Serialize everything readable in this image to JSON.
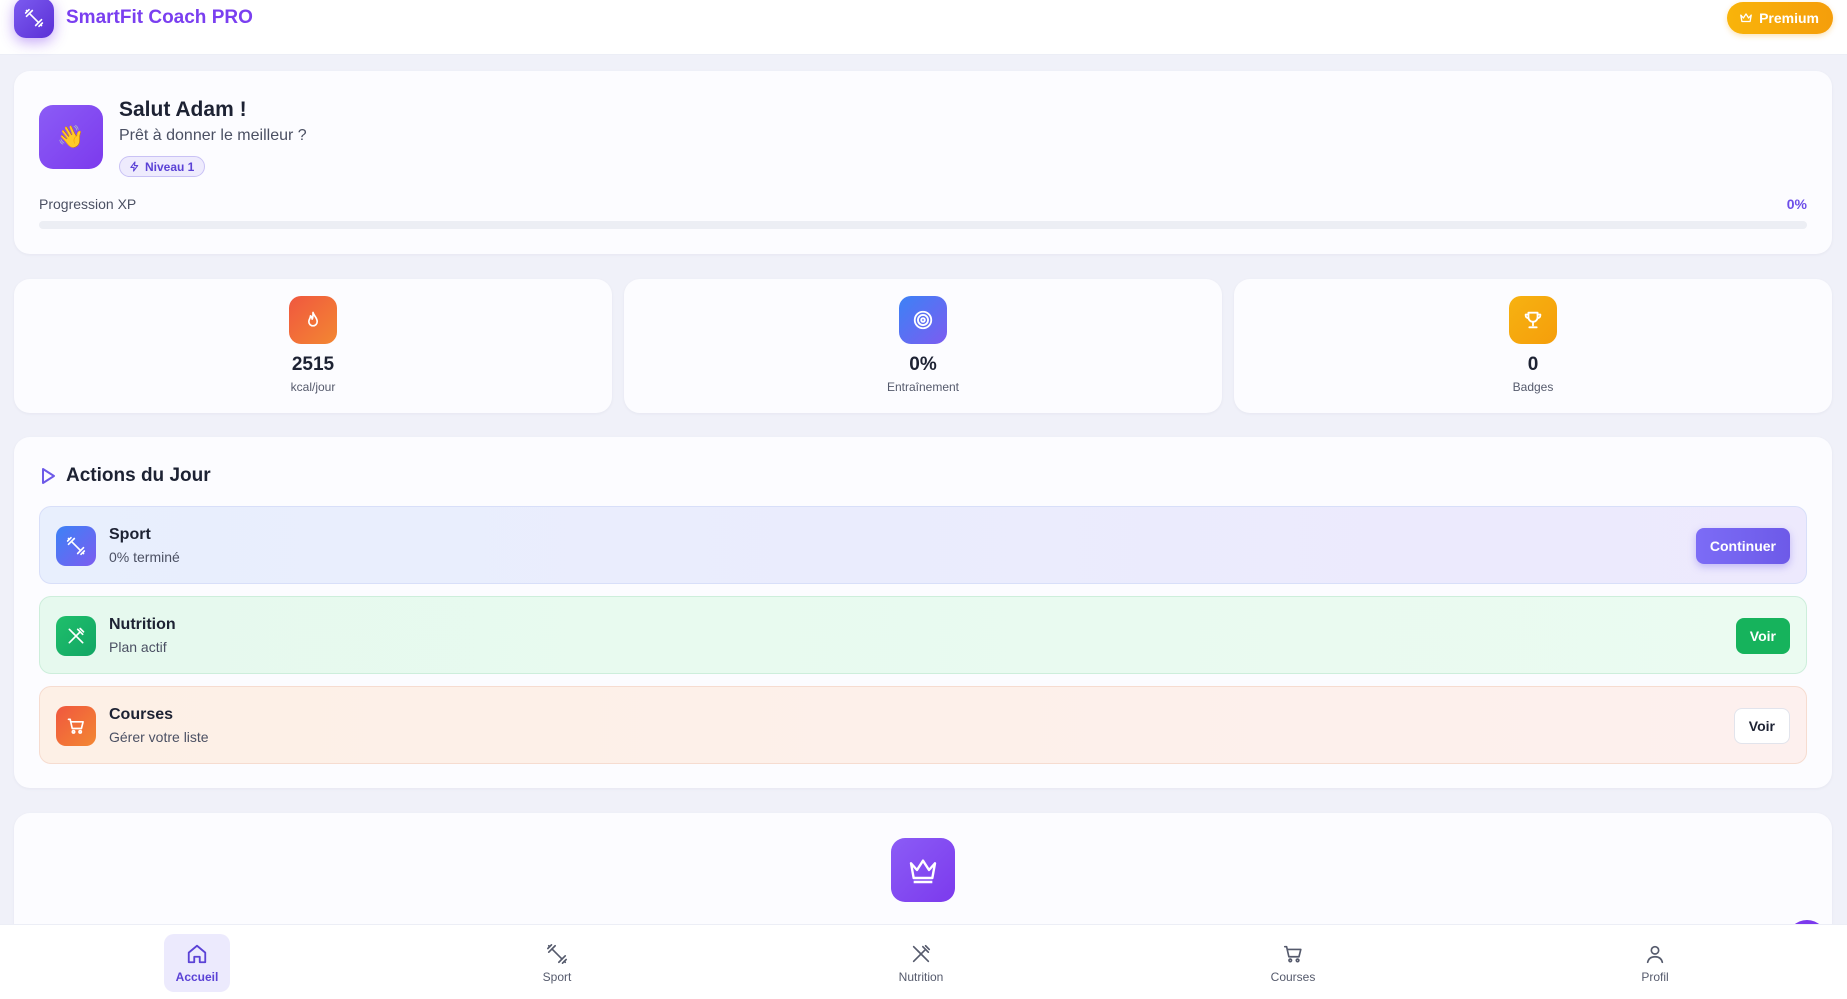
{
  "header": {
    "app_title": "SmartFit Coach PRO",
    "logo_icon": "dumbbell-icon",
    "premium_label": "Premium",
    "premium_icon": "crown-icon"
  },
  "welcome": {
    "greeting": "Salut Adam !",
    "subtitle": "Prêt à donner le meilleur ?",
    "avatar_emoji": "👋",
    "level_label": "Niveau 1",
    "xp_label": "Progression XP",
    "xp_percent_text": "0%",
    "xp_progress": 0
  },
  "stats": [
    {
      "value": "2515",
      "label": "kcal/jour",
      "icon": "flame-icon"
    },
    {
      "value": "0%",
      "label": "Entraînement",
      "icon": "target-icon"
    },
    {
      "value": "0",
      "label": "Badges",
      "icon": "trophy-icon"
    }
  ],
  "actions": {
    "title": "Actions du Jour",
    "title_icon": "play-icon",
    "items": [
      {
        "title": "Sport",
        "subtitle": "0% terminé",
        "button": "Continuer",
        "icon": "dumbbell-icon"
      },
      {
        "title": "Nutrition",
        "subtitle": "Plan actif",
        "button": "Voir",
        "icon": "utensils-icon"
      },
      {
        "title": "Courses",
        "subtitle": "Gérer votre liste",
        "button": "Voir",
        "icon": "cart-icon"
      }
    ]
  },
  "nav": [
    {
      "label": "Accueil",
      "icon": "home-icon",
      "active": true
    },
    {
      "label": "Sport",
      "icon": "dumbbell-icon",
      "active": false
    },
    {
      "label": "Nutrition",
      "icon": "utensils-icon",
      "active": false
    },
    {
      "label": "Courses",
      "icon": "cart-icon",
      "active": false
    },
    {
      "label": "Profil",
      "icon": "user-icon",
      "active": false
    }
  ],
  "colors": {
    "brand": "#7c3aed",
    "premium": "#f59e0b",
    "sport": "#3c82f6",
    "nutrition": "#16b35c",
    "courses": "#f0573f"
  }
}
